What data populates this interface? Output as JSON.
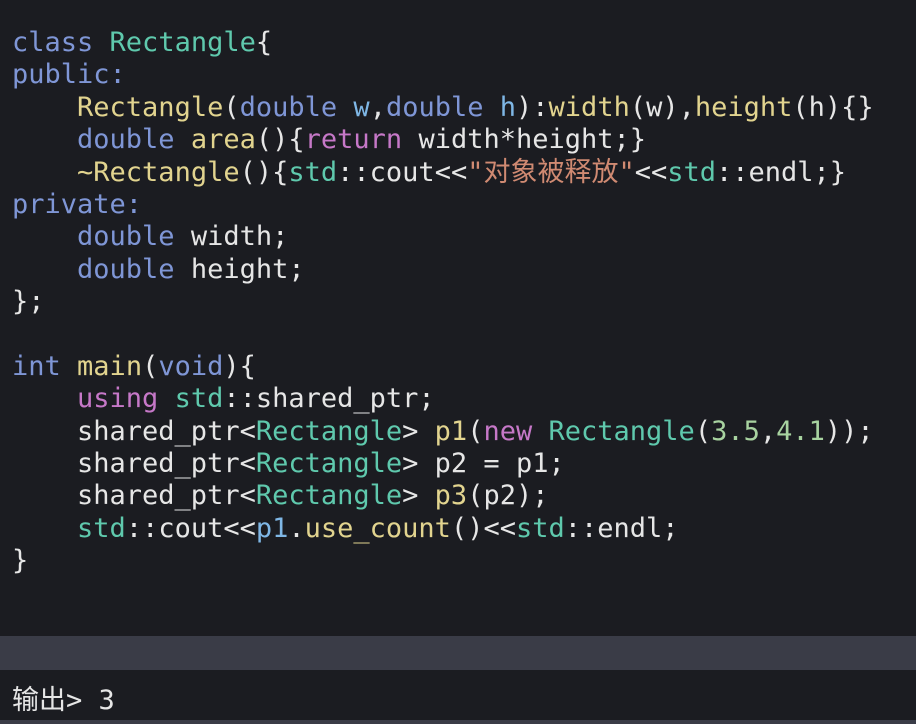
{
  "code": {
    "lines": [
      [
        {
          "c": "ty",
          "t": "class"
        },
        {
          "c": "pl",
          "t": " "
        },
        {
          "c": "cls",
          "t": "Rectangle"
        },
        {
          "c": "pl",
          "t": "{"
        }
      ],
      [
        {
          "c": "ty",
          "t": "public:"
        }
      ],
      [
        {
          "c": "pl",
          "t": "    "
        },
        {
          "c": "fn",
          "t": "Rectangle"
        },
        {
          "c": "pl",
          "t": "("
        },
        {
          "c": "ty",
          "t": "double"
        },
        {
          "c": "pl",
          "t": " "
        },
        {
          "c": "var",
          "t": "w"
        },
        {
          "c": "pl",
          "t": ","
        },
        {
          "c": "ty",
          "t": "double"
        },
        {
          "c": "pl",
          "t": " "
        },
        {
          "c": "var",
          "t": "h"
        },
        {
          "c": "pl",
          "t": "):"
        },
        {
          "c": "fn",
          "t": "width"
        },
        {
          "c": "pl",
          "t": "(w),"
        },
        {
          "c": "fn",
          "t": "height"
        },
        {
          "c": "pl",
          "t": "(h){}"
        }
      ],
      [
        {
          "c": "pl",
          "t": "    "
        },
        {
          "c": "ty",
          "t": "double"
        },
        {
          "c": "pl",
          "t": " "
        },
        {
          "c": "fn",
          "t": "area"
        },
        {
          "c": "pl",
          "t": "(){"
        },
        {
          "c": "ac",
          "t": "return"
        },
        {
          "c": "pl",
          "t": " width*height;}"
        }
      ],
      [
        {
          "c": "pl",
          "t": "    "
        },
        {
          "c": "fn",
          "t": "~Rectangle"
        },
        {
          "c": "pl",
          "t": "(){"
        },
        {
          "c": "ns",
          "t": "std"
        },
        {
          "c": "pl",
          "t": "::cout<<"
        },
        {
          "c": "str",
          "t": "\"对象被释放\""
        },
        {
          "c": "pl",
          "t": "<<"
        },
        {
          "c": "ns",
          "t": "std"
        },
        {
          "c": "pl",
          "t": "::endl;}"
        }
      ],
      [
        {
          "c": "ty",
          "t": "private:"
        }
      ],
      [
        {
          "c": "pl",
          "t": "    "
        },
        {
          "c": "ty",
          "t": "double"
        },
        {
          "c": "pl",
          "t": " width;"
        }
      ],
      [
        {
          "c": "pl",
          "t": "    "
        },
        {
          "c": "ty",
          "t": "double"
        },
        {
          "c": "pl",
          "t": " height;"
        }
      ],
      [
        {
          "c": "pl",
          "t": "};"
        }
      ],
      [
        {
          "c": "pl",
          "t": ""
        }
      ],
      [
        {
          "c": "ty",
          "t": "int"
        },
        {
          "c": "pl",
          "t": " "
        },
        {
          "c": "fn",
          "t": "main"
        },
        {
          "c": "pl",
          "t": "("
        },
        {
          "c": "ty",
          "t": "void"
        },
        {
          "c": "pl",
          "t": "){"
        }
      ],
      [
        {
          "c": "pl",
          "t": "    "
        },
        {
          "c": "ac",
          "t": "using"
        },
        {
          "c": "pl",
          "t": " "
        },
        {
          "c": "ns",
          "t": "std"
        },
        {
          "c": "pl",
          "t": "::shared_ptr;"
        }
      ],
      [
        {
          "c": "pl",
          "t": "    shared_ptr<"
        },
        {
          "c": "cls",
          "t": "Rectangle"
        },
        {
          "c": "pl",
          "t": "> "
        },
        {
          "c": "fn",
          "t": "p1"
        },
        {
          "c": "pl",
          "t": "("
        },
        {
          "c": "ac",
          "t": "new"
        },
        {
          "c": "pl",
          "t": " "
        },
        {
          "c": "cls",
          "t": "Rectangle"
        },
        {
          "c": "pl",
          "t": "("
        },
        {
          "c": "num",
          "t": "3.5"
        },
        {
          "c": "pl",
          "t": ","
        },
        {
          "c": "num",
          "t": "4.1"
        },
        {
          "c": "pl",
          "t": "));"
        }
      ],
      [
        {
          "c": "pl",
          "t": "    shared_ptr<"
        },
        {
          "c": "cls",
          "t": "Rectangle"
        },
        {
          "c": "pl",
          "t": "> p2 = p1;"
        }
      ],
      [
        {
          "c": "pl",
          "t": "    shared_ptr<"
        },
        {
          "c": "cls",
          "t": "Rectangle"
        },
        {
          "c": "pl",
          "t": "> "
        },
        {
          "c": "fn",
          "t": "p3"
        },
        {
          "c": "pl",
          "t": "(p2);"
        }
      ],
      [
        {
          "c": "pl",
          "t": "    "
        },
        {
          "c": "ns",
          "t": "std"
        },
        {
          "c": "pl",
          "t": "::cout<<"
        },
        {
          "c": "var",
          "t": "p1"
        },
        {
          "c": "pl",
          "t": "."
        },
        {
          "c": "fn",
          "t": "use_count"
        },
        {
          "c": "pl",
          "t": "()<<"
        },
        {
          "c": "ns",
          "t": "std"
        },
        {
          "c": "pl",
          "t": "::endl;"
        }
      ],
      [
        {
          "c": "pl",
          "t": "}"
        }
      ]
    ]
  },
  "output": {
    "text": "输出> 3"
  }
}
